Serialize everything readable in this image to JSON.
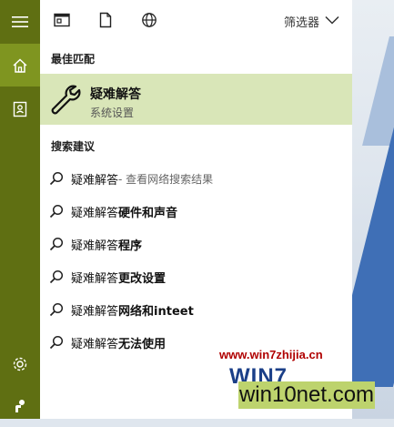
{
  "top_filters": {
    "label": "筛选器"
  },
  "best_match": {
    "heading": "最佳匹配",
    "title": "疑难解答",
    "subtitle": "系统设置"
  },
  "suggestions": {
    "heading": "搜索建议",
    "items": [
      {
        "main": "疑难解答",
        "bold": "",
        "extra": " - 查看网络搜索结果"
      },
      {
        "main": "疑难解答 ",
        "bold": "硬件和声音",
        "extra": ""
      },
      {
        "main": "疑难解答",
        "bold": "程序",
        "extra": ""
      },
      {
        "main": "疑难解答 ",
        "bold": "更改设置",
        "extra": ""
      },
      {
        "main": "疑难解答",
        "bold": "网络和inteet",
        "extra": ""
      },
      {
        "main": "疑难解答",
        "bold": "无法使用",
        "extra": ""
      }
    ]
  },
  "watermark": {
    "url": "www.win7zhijia.cn",
    "logo": "WIN7",
    "site": "win10net.com"
  },
  "icons": {
    "rail": [
      "hamburger-icon",
      "home-icon",
      "notebook-icon",
      "settings-icon",
      "feedback-icon"
    ],
    "topbar": [
      "app-icon",
      "document-icon",
      "globe-icon",
      "chevron-down-icon"
    ],
    "best": "wrench-icon",
    "suggestion": "search-icon"
  },
  "colors": {
    "rail": "#5f6f12",
    "rail_active": "#7f9520",
    "highlight": "#d9e6b8"
  }
}
